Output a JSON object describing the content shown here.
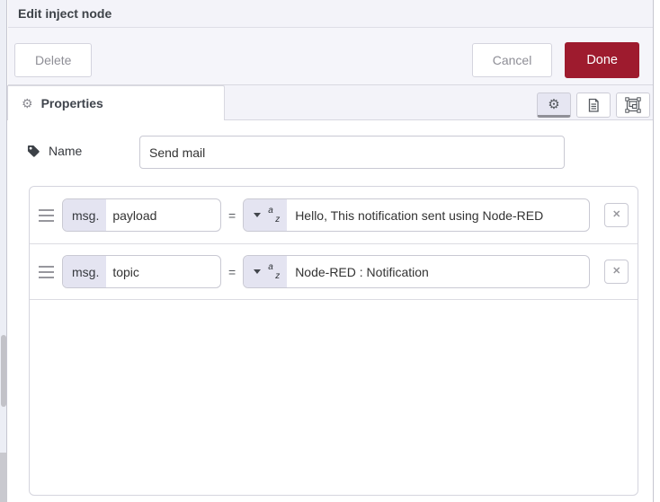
{
  "header": {
    "title": "Edit inject node"
  },
  "toolbar": {
    "delete_label": "Delete",
    "cancel_label": "Cancel",
    "done_label": "Done"
  },
  "tabs": {
    "properties_label": "Properties"
  },
  "icons": {
    "gear": "⚙",
    "az_a": "a",
    "az_z": "z",
    "remove": "✕"
  },
  "form": {
    "name_label": "Name",
    "name_value": "Send mail",
    "props": [
      {
        "prefix": "msg.",
        "field": "payload",
        "operator": "=",
        "value": "Hello, This notification sent using Node-RED"
      },
      {
        "prefix": "msg.",
        "field": "topic",
        "operator": "=",
        "value": "Node-RED : Notification"
      }
    ]
  },
  "colors": {
    "accent_red": "#9e1b2e",
    "lavender": "#e4e4f1",
    "header_bg": "#f3f3f9"
  }
}
